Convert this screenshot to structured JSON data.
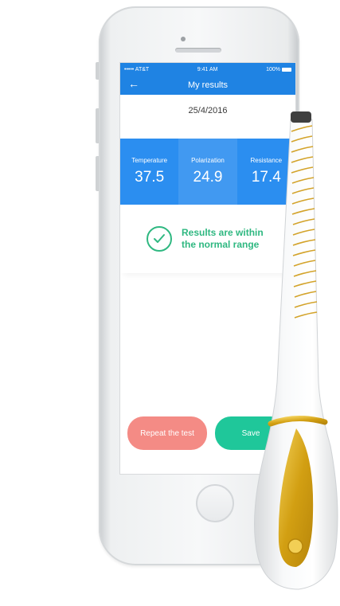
{
  "status_bar": {
    "carrier": "••••• AT&T",
    "time": "9:41 AM",
    "battery": "100%"
  },
  "header": {
    "title": "My results",
    "back_icon": "arrow-left-icon"
  },
  "date": "25/4/2016",
  "metrics": [
    {
      "label": "Temperature",
      "value": "37.5"
    },
    {
      "label": "Polarization",
      "value": "24.9"
    },
    {
      "label": "Resistance",
      "value": "17.4"
    }
  ],
  "result": {
    "icon": "check-circle-icon",
    "text_line1": "Results are within",
    "text_line2": "the normal range",
    "color": "#2fb881"
  },
  "actions": {
    "repeat_label": "Repeat the test",
    "save_label": "Save"
  },
  "colors": {
    "accent": "#1f83e3",
    "success": "#2fb881",
    "danger": "#f48b85",
    "save": "#1fc79a",
    "device_gold": "#d4a620"
  }
}
